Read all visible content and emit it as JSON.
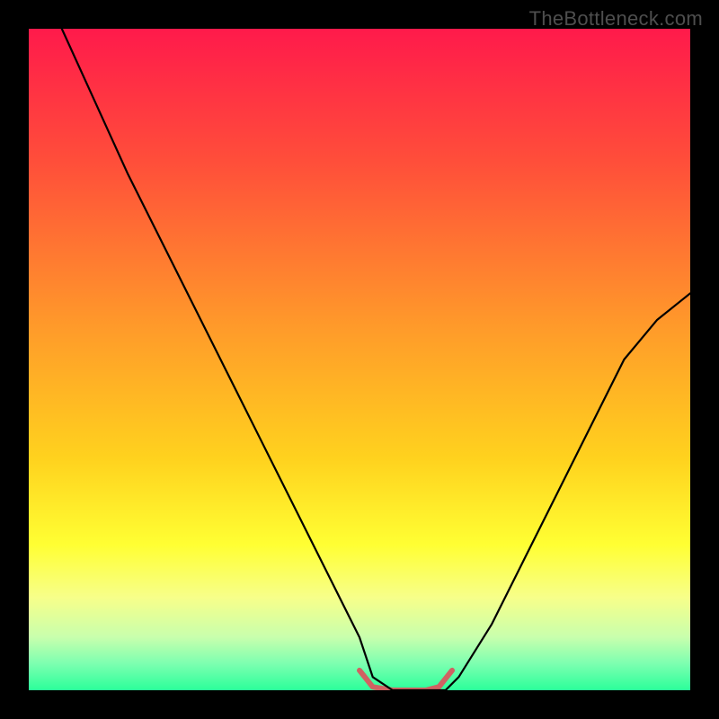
{
  "watermark": "TheBottleneck.com",
  "chart_data": {
    "type": "line",
    "title": "",
    "xlabel": "",
    "ylabel": "",
    "xlim": [
      0,
      100
    ],
    "ylim": [
      0,
      100
    ],
    "grid": false,
    "background_gradient": {
      "stops": [
        {
          "t": 0.0,
          "color": "#ff1a4b"
        },
        {
          "t": 0.2,
          "color": "#ff4e3a"
        },
        {
          "t": 0.45,
          "color": "#ff9a2a"
        },
        {
          "t": 0.65,
          "color": "#ffd21e"
        },
        {
          "t": 0.78,
          "color": "#ffff33"
        },
        {
          "t": 0.86,
          "color": "#f7ff8a"
        },
        {
          "t": 0.92,
          "color": "#c8ffad"
        },
        {
          "t": 0.96,
          "color": "#7cffb0"
        },
        {
          "t": 1.0,
          "color": "#2bff9a"
        }
      ]
    },
    "series": [
      {
        "name": "main-curve",
        "stroke": "#000000",
        "stroke_width": 2.2,
        "x": [
          5,
          10,
          15,
          20,
          25,
          30,
          35,
          40,
          45,
          50,
          52,
          55,
          60,
          63,
          65,
          70,
          75,
          80,
          85,
          90,
          95,
          100
        ],
        "y": [
          100,
          89,
          78,
          68,
          58,
          48,
          38,
          28,
          18,
          8,
          2,
          0,
          0,
          0,
          2,
          10,
          20,
          30,
          40,
          50,
          56,
          60
        ]
      },
      {
        "name": "bottom-accent",
        "stroke": "#d06262",
        "stroke_width": 6,
        "x": [
          50,
          52,
          55,
          58,
          60,
          62,
          64
        ],
        "y": [
          3,
          0.5,
          0,
          0,
          0,
          0.5,
          3
        ]
      }
    ]
  }
}
